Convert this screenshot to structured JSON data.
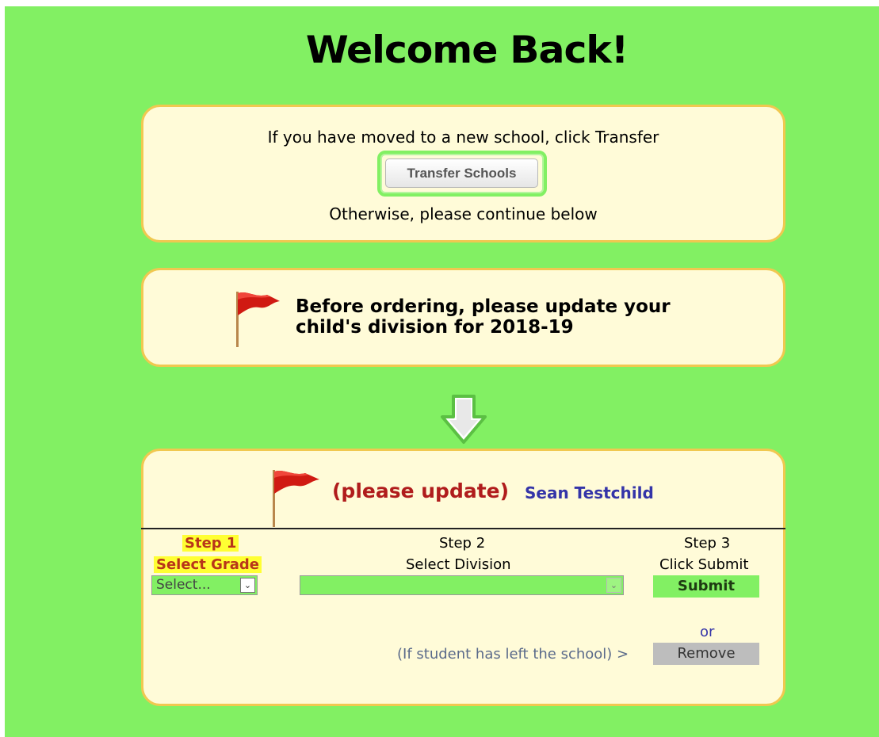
{
  "header": {
    "title": "Welcome Back!"
  },
  "transfer": {
    "prompt": "If you have moved to a new school, click Transfer",
    "button_label": "Transfer Schools",
    "continue_text": "Otherwise, please continue below"
  },
  "notice": {
    "line1": "Before ordering, please update your",
    "line2": "child's division for 2018-19"
  },
  "student": {
    "status": "(please update)",
    "name": "Sean Testchild",
    "step1": {
      "label": "Step 1",
      "action": "Select Grade",
      "select_value": "Select..."
    },
    "step2": {
      "label": "Step 2",
      "action": "Select Division",
      "select_value": ""
    },
    "step3": {
      "label": "Step 3",
      "action": "Click Submit",
      "button_label": "Submit"
    },
    "or_text": "or",
    "left_school_text": "(If student has left the school) >",
    "remove_label": "Remove"
  },
  "colors": {
    "background": "#82f063",
    "panel": "#fffbd8",
    "panel_border": "#f0c850",
    "status": "#b01c1c",
    "name": "#3434a8",
    "highlight": "#ffff33"
  }
}
